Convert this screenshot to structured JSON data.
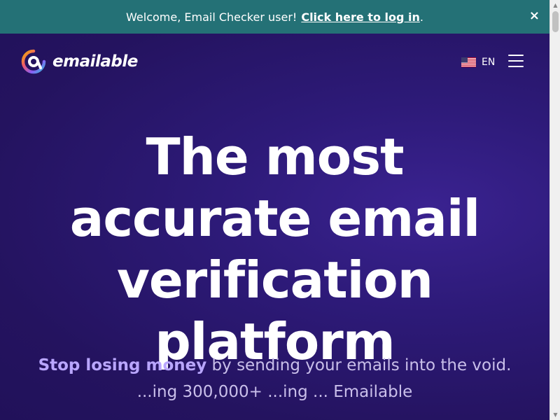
{
  "banner": {
    "message": "Welcome, Email Checker user!",
    "login_link": "Click here to log in",
    "period": ".",
    "close_glyph": "×",
    "background": "#247176"
  },
  "header": {
    "brand": "emailable",
    "language_code": "EN",
    "flag_icon": "us-flag-icon",
    "menu_icon": "hamburger-menu-icon"
  },
  "hero": {
    "headline_lines": [
      "The most",
      "accurate email",
      "verification",
      "platform"
    ],
    "tagline_bold": "Stop losing money",
    "tagline_rest": " by sending your emails into the void.",
    "tagline_partial": "...ing 300,000+ ...ing ... Emailable",
    "background": "#2a1764",
    "accent": "#b9a6ff"
  }
}
